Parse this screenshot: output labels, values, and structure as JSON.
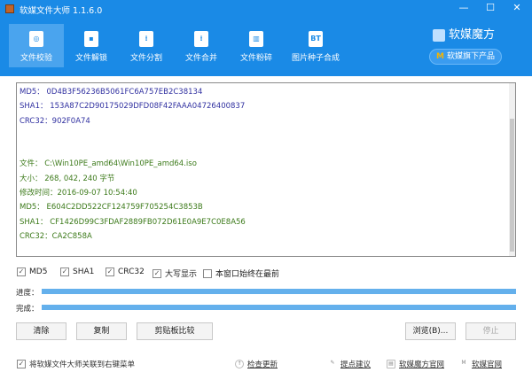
{
  "window": {
    "title": "软媒文件大师 1.1.6.0",
    "minimize": "—",
    "maximize": "☐",
    "close": "✕"
  },
  "tabs": [
    {
      "label": "文件校验",
      "icon": "magnifier-icon",
      "active": true
    },
    {
      "label": "文件解锁",
      "icon": "unlock-icon"
    },
    {
      "label": "文件分割",
      "icon": "zip-split-icon"
    },
    {
      "label": "文件合并",
      "icon": "zip-merge-icon"
    },
    {
      "label": "文件粉碎",
      "icon": "shredder-icon",
      "glyph": ""
    },
    {
      "label": "图片种子合成",
      "icon": "bt-icon",
      "glyph": "BT"
    }
  ],
  "brand": {
    "name": "软媒魔方",
    "products": "软媒旗下产品",
    "products_icon": "M"
  },
  "output": {
    "first": [
      {
        "label": "MD5：",
        "value": "0D4B3F56236B5061FC6A757EB2C38134"
      },
      {
        "label": "SHA1：",
        "value": "153A87C2D90175029DFD08F42FAAA04726400837"
      },
      {
        "label": "CRC32：",
        "value": "902F0A74"
      }
    ],
    "second": [
      {
        "label": "文件：",
        "value": "C:\\Win10PE_amd64\\Win10PE_amd64.iso"
      },
      {
        "label": "大小：",
        "value": "268, 042, 240 字节"
      },
      {
        "label": "修改时间：",
        "value": "2016-09-07 10:54:40"
      },
      {
        "label": "MD5：",
        "value": "E604C2DD522CF124759F705254C3853B"
      },
      {
        "label": "SHA1：",
        "value": "CF1426D99C3FDAF2889FB072D61E0A9E7C0E8A56"
      },
      {
        "label": "CRC32：",
        "value": "CA2C858A"
      }
    ]
  },
  "options": [
    {
      "label": "MD5",
      "checked": true
    },
    {
      "label": "SHA1",
      "checked": true
    },
    {
      "label": "CRC32",
      "checked": true
    },
    {
      "label": "大写显示",
      "checked": true
    },
    {
      "label": "本窗口始终在最前",
      "checked": false
    }
  ],
  "progress": {
    "label": "进度：",
    "value": 100
  },
  "complete": {
    "label": "完成：",
    "value": 100
  },
  "buttons": {
    "clear": "清除",
    "copy": "复制",
    "clipboard_compare": "剪贴板比较",
    "browse": "浏览(B)...",
    "stop": "停止"
  },
  "footer": {
    "context_menu": "将软媒文件大师关联到右键菜单",
    "context_menu_checked": true,
    "check_update": "检查更新",
    "feedback": "提点建议",
    "mofang_site": "软媒魔方官网",
    "ruanmei_site": "软媒官网"
  },
  "colors": {
    "header": "#1a8ae6",
    "hash_first": "#3030a0",
    "hash_second": "#3c7a1a",
    "bar": "#64b0ec"
  }
}
